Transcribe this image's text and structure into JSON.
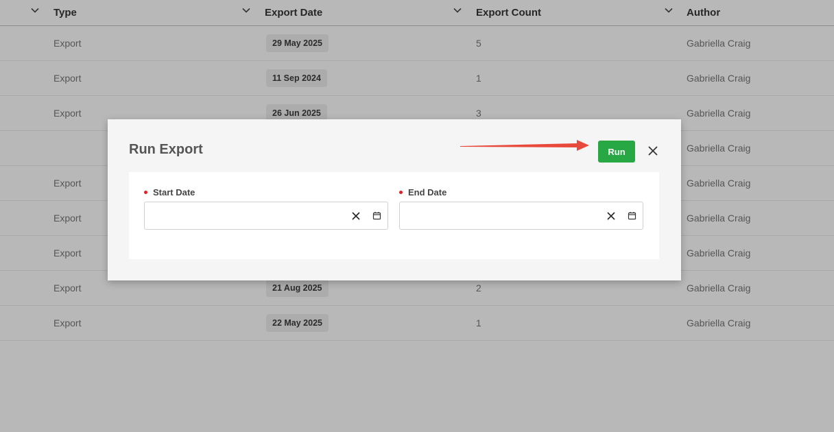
{
  "table": {
    "columns": [
      {
        "label": "Type"
      },
      {
        "label": "Export Date"
      },
      {
        "label": "Export Count"
      },
      {
        "label": "Author"
      }
    ],
    "rows": [
      {
        "type": "Export",
        "date": "29 May 2025",
        "count": "5",
        "author": "Gabriella Craig"
      },
      {
        "type": "Export",
        "date": "11 Sep 2024",
        "count": "1",
        "author": "Gabriella Craig"
      },
      {
        "type": "Export",
        "date": "26 Jun 2025",
        "count": "3",
        "author": "Gabriella Craig"
      },
      {
        "type": "",
        "date": "",
        "count": "",
        "author": "Gabriella Craig"
      },
      {
        "type": "Export",
        "date": "",
        "count": "",
        "author": "Gabriella Craig"
      },
      {
        "type": "Export",
        "date": "",
        "count": "",
        "author": "Gabriella Craig"
      },
      {
        "type": "Export",
        "date": "",
        "count": "",
        "author": "Gabriella Craig"
      },
      {
        "type": "Export",
        "date": "21 Aug 2025",
        "count": "2",
        "author": "Gabriella Craig"
      },
      {
        "type": "Export",
        "date": "22 May 2025",
        "count": "1",
        "author": "Gabriella Craig"
      }
    ]
  },
  "modal": {
    "title": "Run Export",
    "run_label": "Run",
    "close_icon": "close-icon",
    "fields": {
      "start": {
        "label": "Start Date",
        "value": "",
        "required": true
      },
      "end": {
        "label": "End Date",
        "value": "",
        "required": true
      }
    }
  },
  "colors": {
    "overlay": "#b8b8b8",
    "run_button": "#28a745",
    "required_dot": "#d9232a",
    "annotation_arrow": "#e8493a"
  }
}
